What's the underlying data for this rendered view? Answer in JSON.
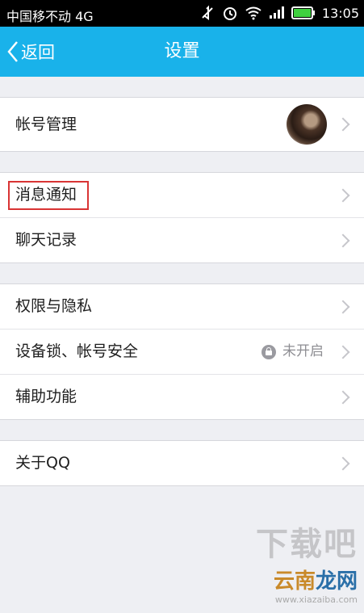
{
  "status_bar": {
    "carrier": "中国移不动 4G",
    "time": "13:05"
  },
  "nav": {
    "back_label": "返回",
    "title": "设置"
  },
  "groups": [
    {
      "items": [
        {
          "label": "帐号管理"
        }
      ]
    },
    {
      "items": [
        {
          "label": "消息通知"
        },
        {
          "label": "聊天记录"
        }
      ]
    },
    {
      "items": [
        {
          "label": "权限与隐私"
        },
        {
          "label": "设备锁、帐号安全",
          "value": "未开启"
        },
        {
          "label": "辅助功能"
        }
      ]
    },
    {
      "items": [
        {
          "label": "关于QQ"
        }
      ]
    }
  ],
  "watermark": {
    "big": "下载吧",
    "brand_a": "云南",
    "brand_b": "龙网",
    "url": "www.xiazaiba.com"
  },
  "colors": {
    "nav_bar": "#19b2ea",
    "highlight": "#d93434",
    "background": "#eeeff3"
  }
}
